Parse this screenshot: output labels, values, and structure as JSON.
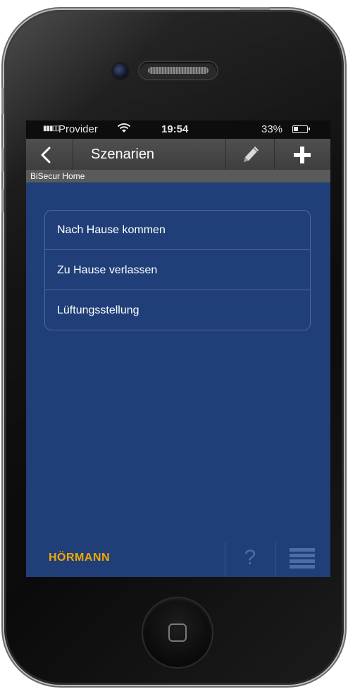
{
  "status_bar": {
    "signal_icon": "signal-bars",
    "carrier": "Provider",
    "wifi_icon": "wifi-icon",
    "time": "19:54",
    "battery_percent": "33%",
    "battery_level": 0.33
  },
  "nav_bar": {
    "back_icon": "chevron-left-icon",
    "title": "Szenarien",
    "edit_icon": "pencil-icon",
    "add_icon": "plus-icon"
  },
  "subheader": {
    "label": "BiSecur Home"
  },
  "scenarios": [
    {
      "label": "Nach Hause kommen"
    },
    {
      "label": "Zu Hause verlassen"
    },
    {
      "label": "Lüftungsstellung"
    }
  ],
  "footer": {
    "brand": "HÖRMANN",
    "help_label": "?",
    "menu_icon": "hamburger-menu-icon"
  },
  "colors": {
    "screen_background": "#203f78",
    "nav_bar": "#464646",
    "subheader": "#5a5a5a",
    "brand": "#f2a800",
    "list_border": "#4d67a0"
  }
}
